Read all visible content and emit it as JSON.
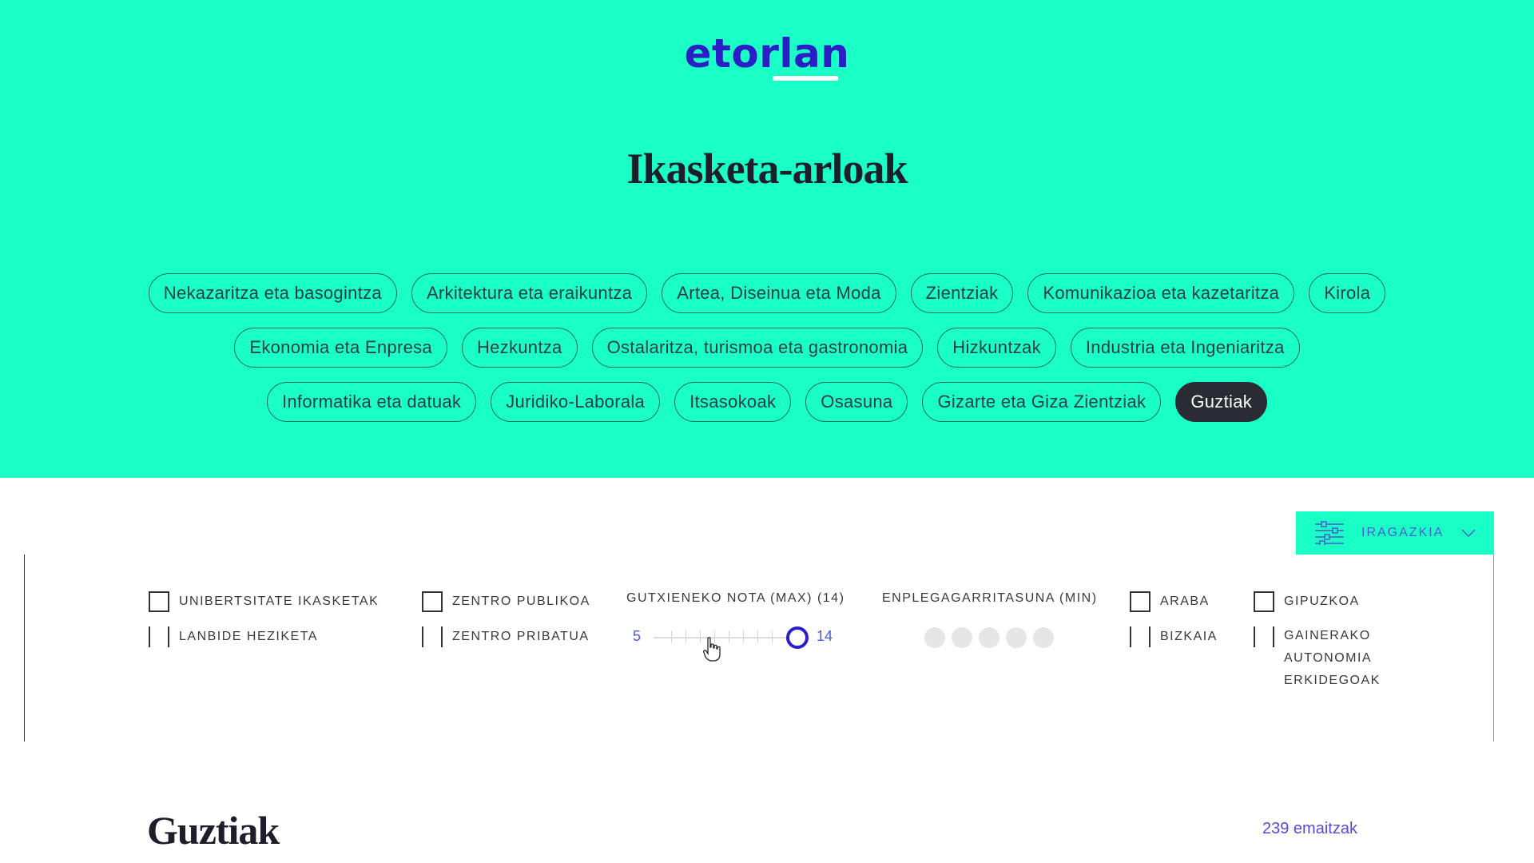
{
  "header": {
    "logo": "etorlan",
    "title": "Ikasketa-arloak"
  },
  "categories": {
    "rows": [
      [
        "Nekazaritza eta basogintza",
        "Arkitektura eta eraikuntza",
        "Artea, Diseinua eta Moda",
        "Zientziak",
        "Komunikazioa eta kazetaritza",
        "Kirola"
      ],
      [
        "Ekonomia eta Enpresa",
        "Hezkuntza",
        "Ostalaritza, turismoa eta gastronomia",
        "Hizkuntzak",
        "Industria eta Ingeniaritza"
      ],
      [
        "Informatika eta datuak",
        "Juridiko-Laborala",
        "Itsasokoak",
        "Osasuna",
        "Gizarte eta Giza Zientziak",
        "Guztiak"
      ]
    ],
    "active": "Guztiak"
  },
  "filter": {
    "button_label": "IRAGAZKIA",
    "study_type": [
      "UNIBERTSITATE IKASKETAK",
      "LANBIDE HEZIKETA"
    ],
    "center_type": [
      "ZENTRO PUBLIKOA",
      "ZENTRO PRIBATUA"
    ],
    "min_grade": {
      "title": "GUTXIENEKO NOTA (MAX) (14)",
      "min": "5",
      "max": "14",
      "value": 14
    },
    "employability": {
      "title": "ENPLEGAGARRITASUNA (MIN)",
      "levels": 5,
      "selected": 0
    },
    "regions_left": [
      "ARABA",
      "BIZKAIA"
    ],
    "regions_right": [
      "GIPUZKOA",
      "GAINERAKO AUTONOMIA ERKIDEGOAK"
    ]
  },
  "results": {
    "title": "Guztiak",
    "count_label": "239 emaitzak"
  },
  "colors": {
    "hero_bg": "#19ffc5",
    "brand": "#2a1fc4",
    "chip_active_bg": "#2b2b33"
  }
}
